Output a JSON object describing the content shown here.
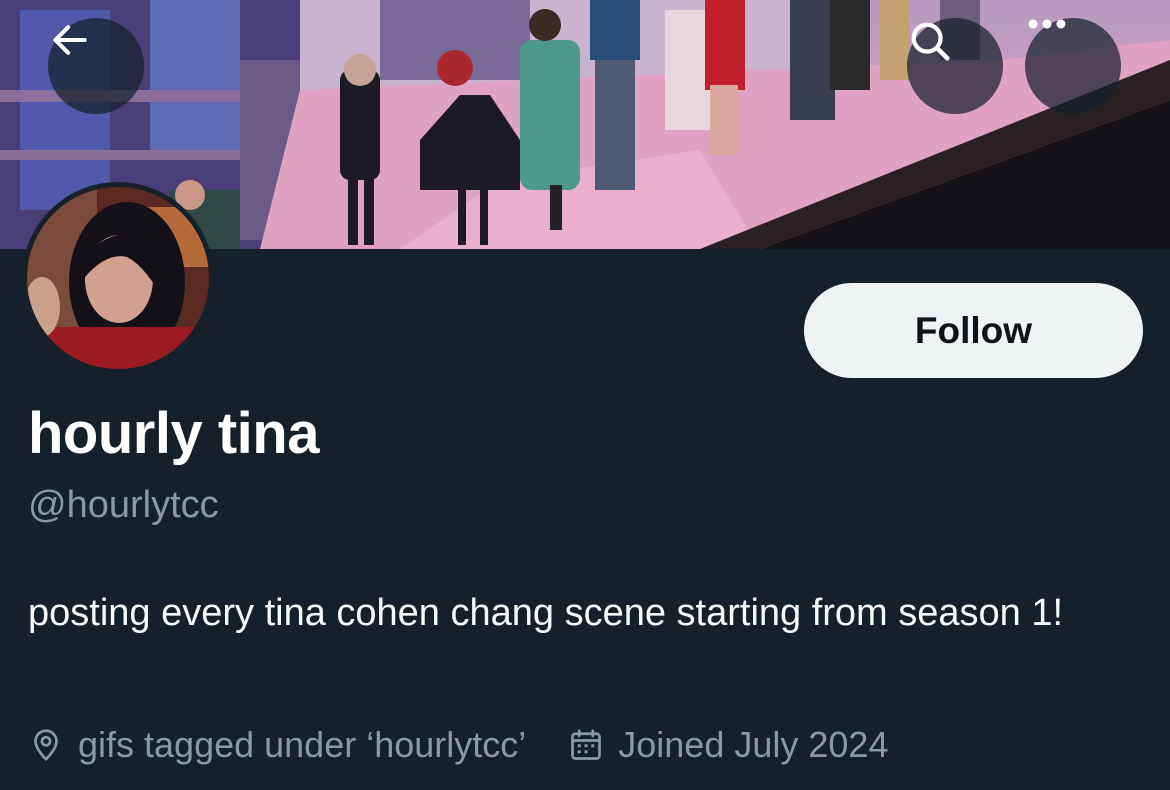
{
  "header": {
    "back_icon": "arrow-left-icon",
    "search_icon": "search-icon",
    "more_icon": "more-horizontal-icon"
  },
  "profile": {
    "display_name": "hourly tina",
    "handle": "@hourlytcc",
    "bio": "posting every tina cohen chang scene starting from season 1!",
    "location": "gifs tagged under ‘hourlytcc’",
    "location_icon": "location-pin-icon",
    "joined": "Joined July 2024",
    "joined_icon": "calendar-icon"
  },
  "actions": {
    "follow_label": "Follow"
  },
  "colors": {
    "background": "#15202b",
    "secondary_text": "#8b98a5",
    "follow_button_bg": "#eff3f4"
  }
}
